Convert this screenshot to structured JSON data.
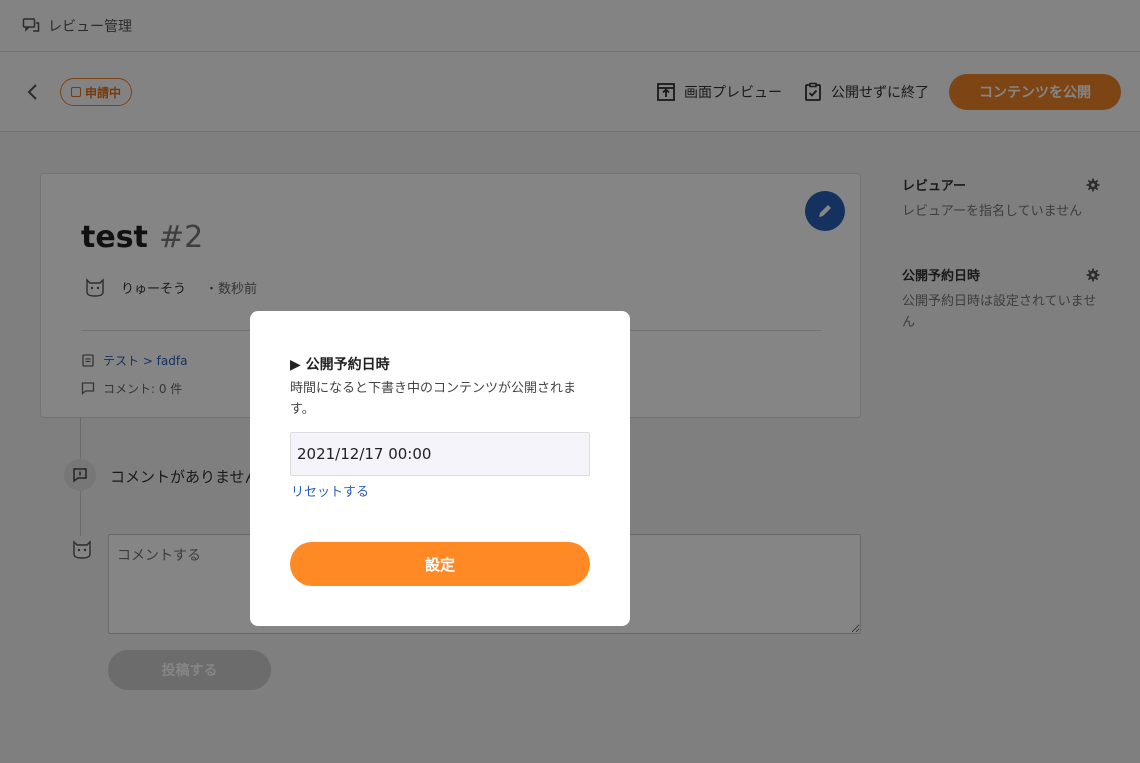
{
  "topbar": {
    "title": "レビュー管理"
  },
  "header": {
    "status_badge": "申請中",
    "preview_label": "画面プレビュー",
    "exit_label": "公開せずに終了",
    "publish_label": "コンテンツを公開"
  },
  "content": {
    "title": "test",
    "number": "#2",
    "author": "りゅーそう",
    "time": "・数秒前",
    "breadcrumb": "テスト > fadfa",
    "comment_count": "コメント: 0 件"
  },
  "timeline": {
    "no_comments": "コメントがありません",
    "comment_placeholder": "コメントする",
    "post_label": "投稿する"
  },
  "sidebar": {
    "reviewer_heading": "レビュアー",
    "reviewer_text": "レビュアーを指名していません",
    "schedule_heading": "公開予約日時",
    "schedule_text": "公開予約日時は設定されていません"
  },
  "modal": {
    "title": "▶ 公開予約日時",
    "description": "時間になると下書き中のコンテンツが公開されます。",
    "date_value": "2021/12/17 00:00",
    "reset_label": "リセットする",
    "set_label": "設定"
  },
  "colors": {
    "accent": "#f08428",
    "link": "#2a5fb8",
    "fab": "#2a5fb8"
  }
}
